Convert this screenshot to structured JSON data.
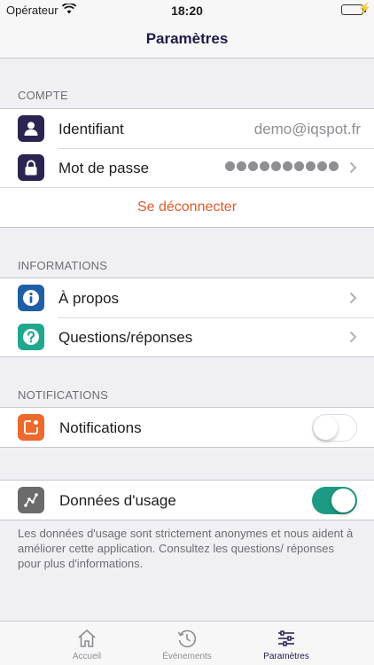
{
  "status_bar": {
    "carrier": "Opérateur",
    "time": "18:20"
  },
  "nav": {
    "title": "Paramètres"
  },
  "sections": {
    "account": {
      "header": "Compte",
      "identifier_label": "Identifiant",
      "identifier_value": "demo@iqspot.fr",
      "password_label": "Mot de passe",
      "logout_label": "Se déconnecter"
    },
    "information": {
      "header": "Informations",
      "about_label": "À propos",
      "faq_label": "Questions/réponses"
    },
    "notifications": {
      "header": "Notifications",
      "notifications_label": "Notifications",
      "notifications_enabled": false
    },
    "usage": {
      "usage_label": "Données d'usage",
      "usage_enabled": true,
      "footnote": "Les données d'usage sont strictement anonymes et nous aident à améliorer cette application. Consultez les questions/ réponses pour plus d'informations."
    }
  },
  "tab_bar": {
    "tabs": [
      {
        "label": "Accueil",
        "icon": "home-icon",
        "selected": false
      },
      {
        "label": "Événements",
        "icon": "history-icon",
        "selected": false
      },
      {
        "label": "Paramètres",
        "icon": "sliders-icon",
        "selected": true
      }
    ]
  },
  "colors": {
    "nav_title": "#1e1b4b",
    "account_icon_bg": "#2a2450",
    "about_icon_bg": "#1f5fa6",
    "faq_icon_bg": "#20a88e",
    "notification_icon_bg": "#ee6a2c",
    "usage_icon_bg": "#6b6b6b",
    "logout": "#e05a2b",
    "toggle_on": "#1d9a83",
    "tab_selected": "#1e1b4b",
    "tab_unselected": "#8e8e93"
  }
}
